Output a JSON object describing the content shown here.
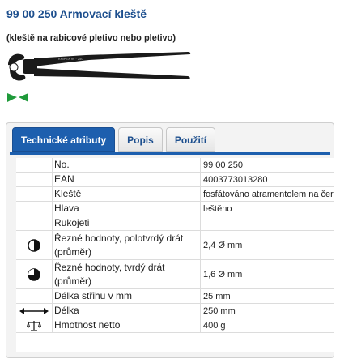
{
  "product": {
    "title": "99 00 250 Armovací kleště",
    "subtitle": "(kleště na rabicové pletivo nebo pletivo)",
    "badge_color": "#1f9a3a"
  },
  "tabs": [
    {
      "label": "Technické atributy",
      "active": true
    },
    {
      "label": "Popis",
      "active": false
    },
    {
      "label": "Použití",
      "active": false
    }
  ],
  "attributes": [
    {
      "icon": "",
      "label": "No.",
      "value": "99 00 250"
    },
    {
      "icon": "",
      "label": "EAN",
      "value": "4003773013280"
    },
    {
      "icon": "",
      "label": "Kleště",
      "value": "fosfátováno atramentolem na černo"
    },
    {
      "icon": "",
      "label": "Hlava",
      "value": "leštěno"
    },
    {
      "icon": "",
      "label": "Rukojeti",
      "value": ""
    },
    {
      "icon": "half-circle-icon",
      "label": "Řezné hodnoty, polotvrdý drát (průměr)",
      "value": "2,4 Ø mm"
    },
    {
      "icon": "three-quarter-circle-icon",
      "label": "Řezné hodnoty, tvrdý drát (průměr)",
      "value": "1,6 Ø mm"
    },
    {
      "icon": "",
      "label": "Délka střihu v mm",
      "value": "25 mm"
    },
    {
      "icon": "double-arrow-icon",
      "label": "Délka",
      "value": "250 mm"
    },
    {
      "icon": "scale-icon",
      "label": "Hmotnost netto",
      "value": "400 g"
    }
  ]
}
